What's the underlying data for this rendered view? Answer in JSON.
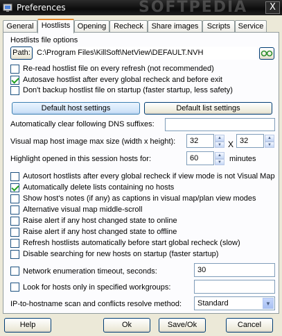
{
  "window": {
    "title": "Preferences",
    "close_label": "X"
  },
  "tabs": [
    "General",
    "Hostlists",
    "Opening",
    "Recheck",
    "Share images",
    "Scripts",
    "Service"
  ],
  "hostlists_file": {
    "group_label": "Hostlists file options",
    "path_button": "Path:",
    "path_value": "C:\\Program Files\\KillSoft\\NetView\\DEFAULT.NVH"
  },
  "file_options": [
    {
      "label": "Re-read hostlist file on every refresh (not recommended)",
      "checked": false
    },
    {
      "label": "Autosave hostlist after every global recheck and before exit",
      "checked": true
    },
    {
      "label": "Don't backup hostlist file on startup (faster startup, less safety)",
      "checked": false
    }
  ],
  "buttons": {
    "default_host": "Default host settings",
    "default_list": "Default list settings",
    "help": "Help",
    "ok": "Ok",
    "save_ok": "Save/Ok",
    "cancel": "Cancel"
  },
  "dns": {
    "label": "Automatically clear following DNS suffixes:",
    "value": ""
  },
  "visual_map": {
    "label": "Visual map host image max size (width x height):",
    "width": "32",
    "x_sep": "X",
    "height": "32"
  },
  "highlight": {
    "label": "Highlight opened in this session hosts for:",
    "value": "60",
    "unit": "minutes"
  },
  "options": [
    {
      "label": "Autosort hostlists after every global recheck if view mode is not Visual Map",
      "checked": false
    },
    {
      "label": "Automatically delete lists containing no hosts",
      "checked": true
    },
    {
      "label": "Show host's notes (if any) as captions in visual map/plan view modes",
      "checked": false
    },
    {
      "label": "Alternative visual map middle-scroll",
      "checked": false
    },
    {
      "label": "Raise alert if any host changed state to online",
      "checked": false
    },
    {
      "label": "Raise alert if any host changed state to offline",
      "checked": false
    },
    {
      "label": "Refresh hostlists automatically before start global recheck (slow)",
      "checked": false
    },
    {
      "label": "Disable searching for new hosts on startup (faster startup)",
      "checked": false
    }
  ],
  "network_timeout": {
    "label": "Network enumeration timeout, seconds:",
    "checked": false,
    "value": "30"
  },
  "workgroups": {
    "label": "Look for hosts only in specified workgroups:",
    "checked": false,
    "value": ""
  },
  "ip_resolve": {
    "label": "IP-to-hostname scan and conflicts resolve method:",
    "selected": "Standard"
  },
  "watermark": "SOFTPEDIA",
  "colors": {
    "titlebar": "#111111",
    "accent": "#e68b2c",
    "check": "#21a121"
  },
  "icons": {
    "app": "netview-app-icon",
    "path_browse": "browse-folder-icon",
    "dropdown": "chevron-down-icon"
  }
}
